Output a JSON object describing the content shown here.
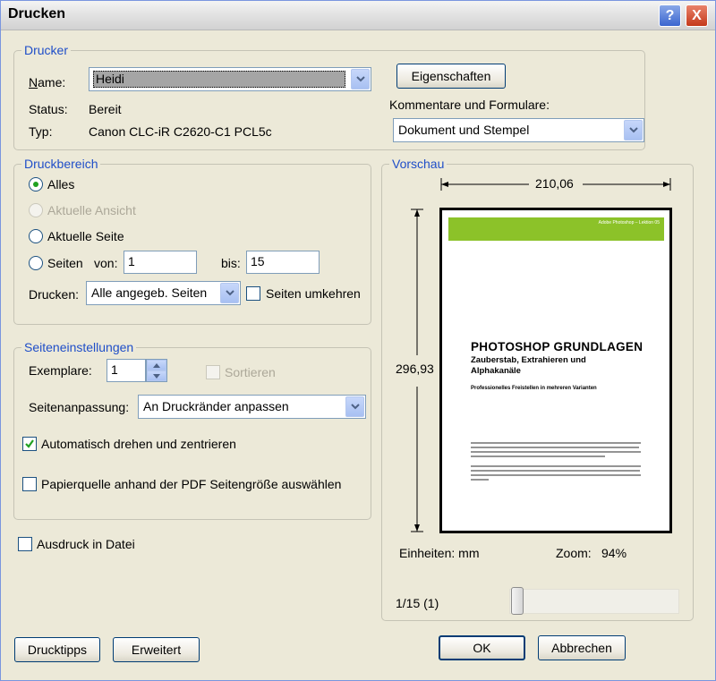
{
  "window": {
    "title": "Drucken",
    "help": "?",
    "close": "X"
  },
  "printer": {
    "legend": "Drucker",
    "name_label": "Name:",
    "name_value": "Heidi",
    "status_label": "Status:",
    "status_value": "Bereit",
    "type_label": "Typ:",
    "type_value": "Canon CLC-iR C2620-C1 PCL5c",
    "properties_button": "Eigenschaften",
    "comments_label": "Kommentare und Formulare:",
    "comments_value": "Dokument und Stempel"
  },
  "range": {
    "legend": "Druckbereich",
    "all": "Alles",
    "current_view": "Aktuelle Ansicht",
    "current_page": "Aktuelle Seite",
    "pages": "Seiten",
    "from_label": "von:",
    "from_value": "1",
    "to_label": "bis:",
    "to_value": "15",
    "print_label": "Drucken:",
    "print_value": "Alle angegeb. Seiten",
    "reverse_label": "Seiten umkehren"
  },
  "page_setup": {
    "legend": "Seiteneinstellungen",
    "copies_label": "Exemplare:",
    "copies_value": "1",
    "collate_label": "Sortieren",
    "scaling_label": "Seitenanpassung:",
    "scaling_value": "An Druckränder anpassen",
    "auto_rotate_label": "Automatisch drehen und zentrieren",
    "auto_rotate_checked": true,
    "paper_source_label": "Papierquelle anhand der PDF Seitengröße auswählen"
  },
  "print_to_file_label": "Ausdruck in Datei",
  "preview": {
    "legend": "Vorschau",
    "width": "210,06",
    "height": "296,93",
    "units": "Einheiten: mm",
    "zoom_label": "Zoom:",
    "zoom_value": "94%",
    "page_counter": "1/15 (1)",
    "doc_header": "Adobe Photoshop – Lektion 05",
    "doc_title": "PHOTOSHOP GRUNDLAGEN",
    "doc_subtitle": "Zauberstab, Extrahieren und Alphakanäle",
    "doc_tagline": "Professionelles Freistellen in mehreren Varianten"
  },
  "buttons": {
    "tips": "Drucktipps",
    "advanced": "Erweitert",
    "ok": "OK",
    "cancel": "Abbrechen"
  },
  "colors": {
    "legend_blue": "#1f4ec8",
    "preview_band": "#8cc229",
    "dialog_bg": "#ece9d8"
  }
}
